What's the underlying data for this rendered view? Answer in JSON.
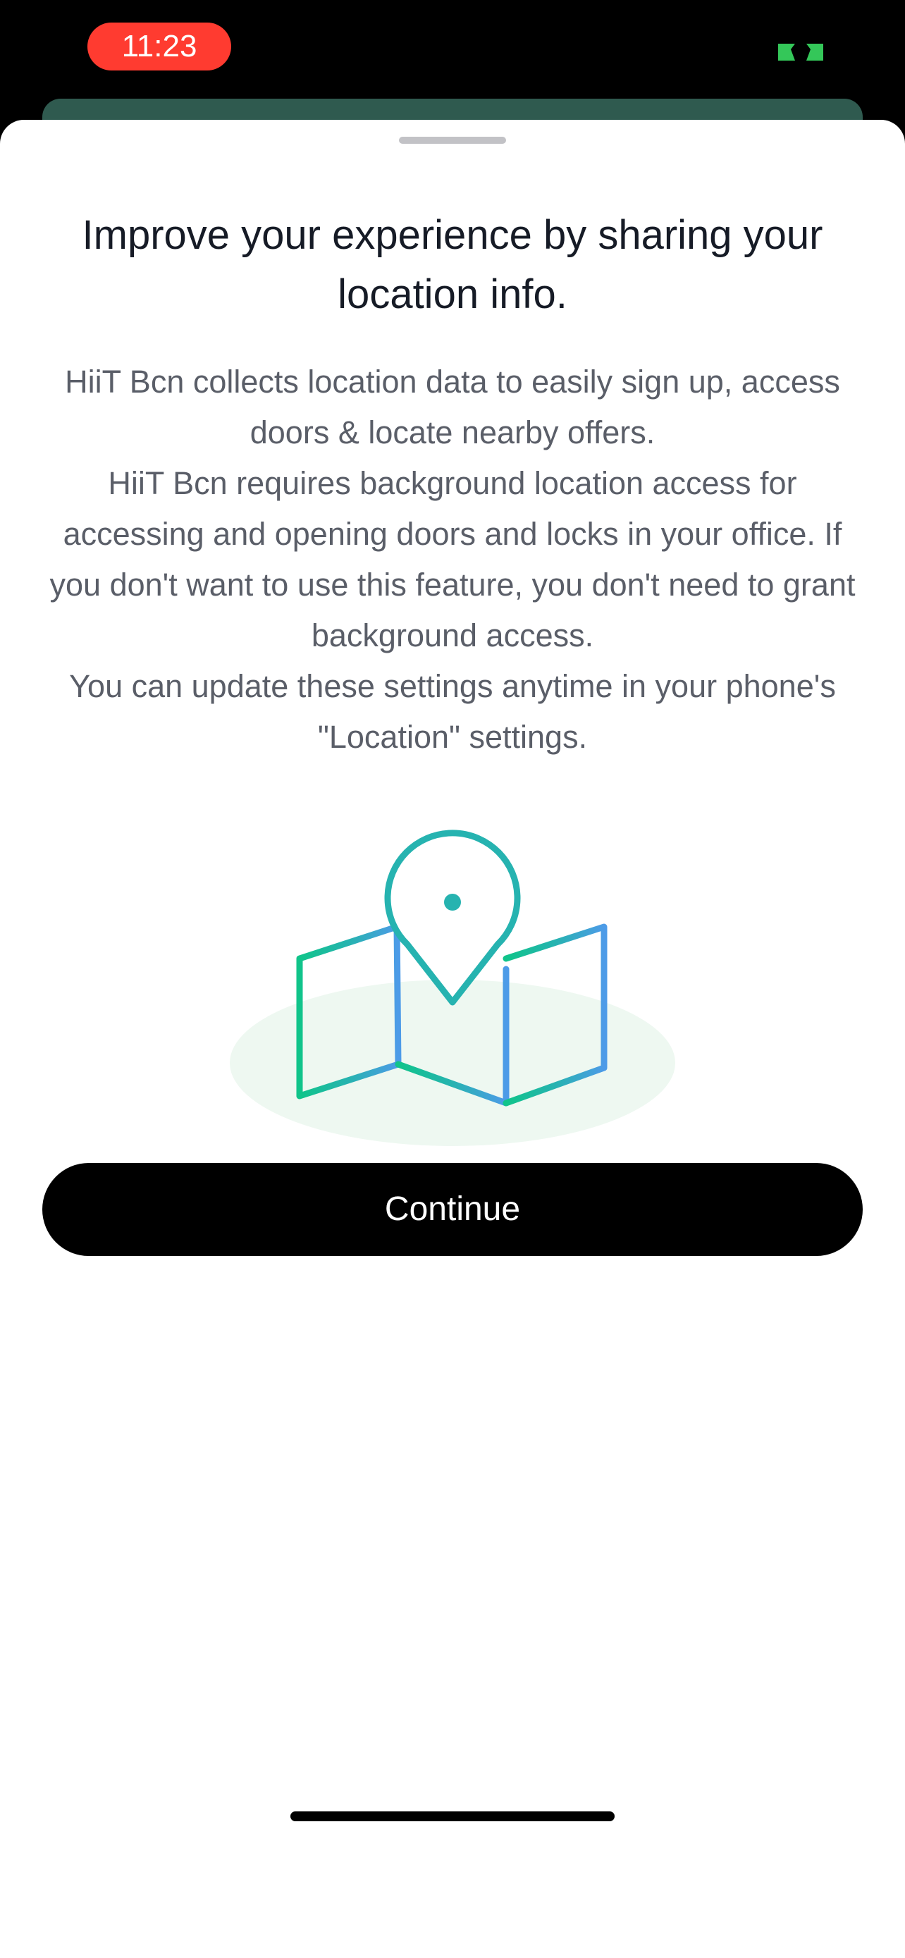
{
  "status_bar": {
    "time": "11:23",
    "indicator_color": "#34c759",
    "time_pill_color": "#ff3b30"
  },
  "sheet": {
    "title": "Improve your experience by sharing your location info.",
    "paragraphs": [
      "HiiT Bcn collects location data to easily sign up, access doors & locate nearby offers.",
      "HiiT Bcn requires background location access for accessing and opening doors and locks in your office. If you don't want to use this feature, you don't need to grant background access.",
      "You can update these settings anytime in your phone's \"Location\" settings."
    ],
    "illustration_icons": [
      "map-icon",
      "location-pin-icon"
    ],
    "continue_label": "Continue"
  },
  "colors": {
    "gradient_start": "#10c48a",
    "gradient_mid": "#26b3b0",
    "gradient_end": "#4d9be8",
    "illustration_backdrop": "#eef8f1",
    "button": "#000000",
    "behind_sheet": "#2f5a4f"
  }
}
